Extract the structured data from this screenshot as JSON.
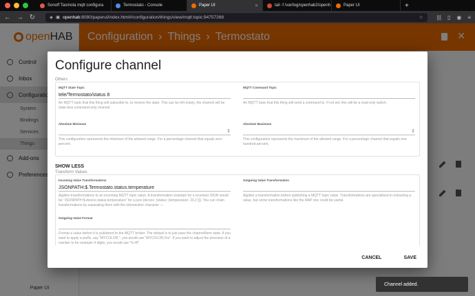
{
  "browser": {
    "tabs": [
      {
        "label": "Sonoff Tasmota mqtt configura",
        "active": false,
        "color": "#e15a4a"
      },
      {
        "label": "Termostato - Console",
        "active": false,
        "color": "#4b8fe0"
      },
      {
        "label": "Paper UI",
        "active": true,
        "color": "#ef6c00"
      },
      {
        "label": "tail -f /var/log/openhab2/openh",
        "active": false,
        "color": "#d14b3a"
      },
      {
        "label": "Paper UI",
        "active": false,
        "color": "#ef6c00"
      }
    ],
    "url_host": "openhab",
    "url_rest": ":8080/paperui/index.html#/configuration/things/view/mqtt:topic:94757268"
  },
  "sidebar": {
    "logo_prefix": "open",
    "logo_suffix": "HAB",
    "items": [
      {
        "label": "Control"
      },
      {
        "label": "Inbox"
      },
      {
        "label": "Configuration"
      },
      {
        "label": "Add-ons"
      },
      {
        "label": "Preferences"
      }
    ],
    "subitems": [
      {
        "label": "System"
      },
      {
        "label": "Bindings"
      },
      {
        "label": "Services"
      },
      {
        "label": "Things"
      }
    ],
    "footer": "Paper UI"
  },
  "header": {
    "crumbs": [
      "Configuration",
      "Things",
      "Termostato"
    ]
  },
  "dialog": {
    "title": "Configure channel",
    "group1_label": "Others",
    "state_topic": {
      "label": "MQTT State Topic",
      "value": "tele/Termostato/status 8",
      "help": "An MQTT topic that this thing will subscribe to, to receive the state. This can be left empty, the channel will be state-less command-only channel."
    },
    "command_topic": {
      "label": "MQTT Command Topic",
      "value": "",
      "help": "An MQTT topic that this thing will send a command to. If not set, this will be a read-only switch."
    },
    "abs_min": {
      "label": "Absolute Minimum",
      "value": "",
      "help": "This configuration represents the minimum of the allowed range. For a percentage channel that equals zero percent."
    },
    "abs_max": {
      "label": "Absolute Maximum",
      "value": "",
      "help": "This configuration represents the maximum of the allowed range. For a percentage channel that equals one hundred percent."
    },
    "show_less": "SHOW LESS",
    "group2_label": "Transform Values",
    "in_transform": {
      "label": "Incoming Value Transformations",
      "value": "JSONPATH:$.Termostato.status.temperature",
      "help": "Applies transformations to an incoming MQTT topic value. A transformation example for a received JSON would be \"JSONPATH:$.device.status.temperature\" for a json {device: {status: {temperature: 23.2 }}}. You can chain transformations by separating them with the intersection character ∩."
    },
    "out_transform": {
      "label": "Outgoing Value Transformation",
      "value": "",
      "help": "Applies a transformation before publishing a MQTT topic value. Transformations are specialised in extracting a value, but some transformations like the MAP one could be useful."
    },
    "out_format": {
      "label": "Outgoing Value Format",
      "value": "",
      "help": "Format a value before it is published to the MQTT broker. The default is to just pass the channel/item state. If you want to apply a prefix, say \"MYCOLOR,\", you would use \"MYCOLOR,%s\". If you want to adjust the precision of a number to for example 4 digits, you would use \"%.4f\"."
    },
    "cancel": "CANCEL",
    "save": "SAVE"
  },
  "toast": "Channel added."
}
